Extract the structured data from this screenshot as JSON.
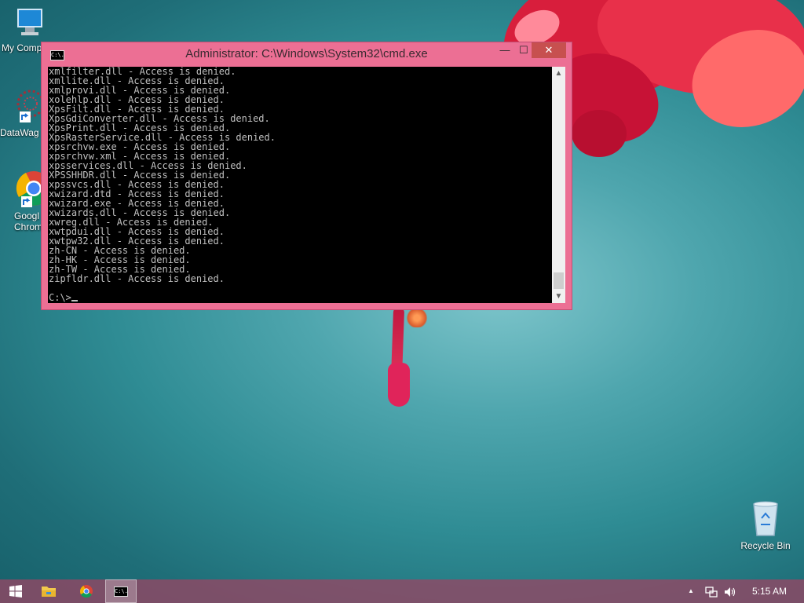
{
  "desktop": {
    "icons": [
      {
        "label": "My Comp",
        "icon": "computer-icon"
      },
      {
        "label": "DataWag",
        "icon": "datawag-shortcut-icon"
      },
      {
        "label": "Googl",
        "label2": "Chrom",
        "icon": "chrome-icon"
      },
      {
        "label": "Recycle Bin",
        "icon": "recycle-bin-icon"
      }
    ]
  },
  "window": {
    "title": "Administrator:  C:\\Windows\\System32\\cmd.exe",
    "app_icon_text": "C:\\.",
    "buttons": {
      "minimize": "—",
      "maximize": "☐",
      "close": "✕"
    },
    "console_lines": [
      "xmlfilter.dll - Access is denied.",
      "xmllite.dll - Access is denied.",
      "xmlprovi.dll - Access is denied.",
      "xolehlp.dll - Access is denied.",
      "XpsFilt.dll - Access is denied.",
      "XpsGdiConverter.dll - Access is denied.",
      "XpsPrint.dll - Access is denied.",
      "XpsRasterService.dll - Access is denied.",
      "xpsrchvw.exe - Access is denied.",
      "xpsrchvw.xml - Access is denied.",
      "xpsservices.dll - Access is denied.",
      "XPSSHHDR.dll - Access is denied.",
      "xpssvcs.dll - Access is denied.",
      "xwizard.dtd - Access is denied.",
      "xwizard.exe - Access is denied.",
      "xwizards.dll - Access is denied.",
      "xwreg.dll - Access is denied.",
      "xwtpdui.dll - Access is denied.",
      "xwtpw32.dll - Access is denied.",
      "zh-CN - Access is denied.",
      "zh-HK - Access is denied.",
      "zh-TW - Access is denied.",
      "zipfldr.dll - Access is denied."
    ],
    "prompt": "C:\\>",
    "colors": {
      "frame": "#ec6f94",
      "console_bg": "#000000",
      "console_text": "#c0c0c0"
    }
  },
  "taskbar": {
    "items": [
      {
        "icon": "windows-start-icon"
      },
      {
        "icon": "file-explorer-icon"
      },
      {
        "icon": "chrome-icon"
      },
      {
        "icon": "cmd-icon",
        "text": "C:\\."
      }
    ],
    "tray": {
      "time": "5:15 AM",
      "icons": [
        "show-hidden-icons-chevron-icon",
        "network-icon",
        "volume-icon"
      ],
      "chevron": "▲"
    }
  }
}
